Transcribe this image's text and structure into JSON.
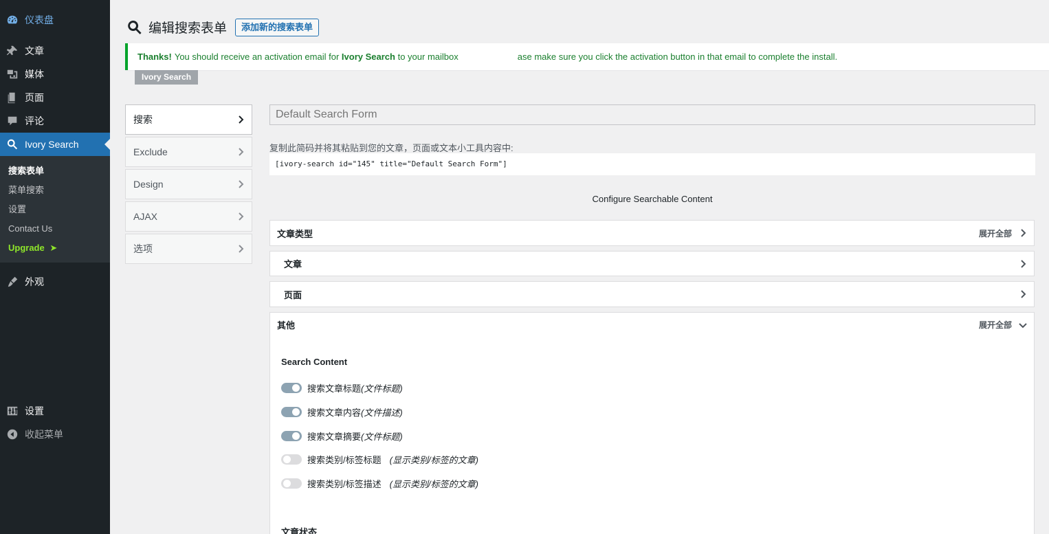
{
  "sidebar": {
    "items_top": [
      {
        "label": "仪表盘",
        "icon": "dashboard-icon"
      },
      {
        "label": "文章",
        "icon": "pushpin-icon"
      },
      {
        "label": "媒体",
        "icon": "media-icon"
      },
      {
        "label": "页面",
        "icon": "page-icon"
      },
      {
        "label": "评论",
        "icon": "comment-icon"
      },
      {
        "label": "Ivory Search",
        "icon": "search-icon"
      }
    ],
    "submenu": [
      "搜索表单",
      "菜单搜索",
      "设置",
      "Contact Us",
      "Upgrade"
    ],
    "upgrade_arrow": "➤",
    "appearance": "外观",
    "settings": "设置",
    "collapse": "收起菜单"
  },
  "header": {
    "title": "编辑搜索表单",
    "add_new": "添加新的搜索表单"
  },
  "notice": {
    "strong_thanks": "Thanks!",
    "text_1": "You should receive an activation email for",
    "strong_plugin": "Ivory Search",
    "text_2": "to your mailbox",
    "text_3": "ase make sure you click the activation button in that email to complete the install."
  },
  "plugin_tag": "Ivory Search",
  "tabs": [
    "搜索",
    "Exclude",
    "Design",
    "AJAX",
    "选项"
  ],
  "form": {
    "name_placeholder": "Default Search Form",
    "shortcode_label": "复制此简码并将其粘贴到您的文章，页面或文本小工具内容中:",
    "shortcode": "[ivory-search id=\"145\" title=\"Default Search Form\"]",
    "configure_title": "Configure Searchable Content"
  },
  "panels": {
    "post_types": {
      "title": "文章类型",
      "expand": "展开全部"
    },
    "posts": {
      "title": "文章"
    },
    "pages": {
      "title": "页面"
    },
    "other": {
      "title": "其他",
      "expand": "展开全部"
    }
  },
  "search_content": {
    "title": "Search Content",
    "toggles": [
      {
        "label": "搜索文章标题",
        "note": "(文件标题)",
        "on": true
      },
      {
        "label": "搜索文章内容",
        "note": "(文件描述)",
        "on": true
      },
      {
        "label": "搜索文章摘要",
        "note": "(文件标题)",
        "on": true
      },
      {
        "label": "搜索类别/标签标题",
        "note": "(显示类别/标签的文章)",
        "on": false
      },
      {
        "label": "搜索类别/标签描述",
        "note": "(显示类别/标签的文章)",
        "on": false
      }
    ]
  },
  "post_status_title": "文章状态",
  "colors": {
    "sidebar_bg": "#1d2327",
    "submenu_bg": "#2c3338",
    "active_blue": "#2271b1",
    "notice_green": "#00a32a",
    "upgrade_green": "#8fe62a",
    "toggle_on": "#8da3b2"
  }
}
